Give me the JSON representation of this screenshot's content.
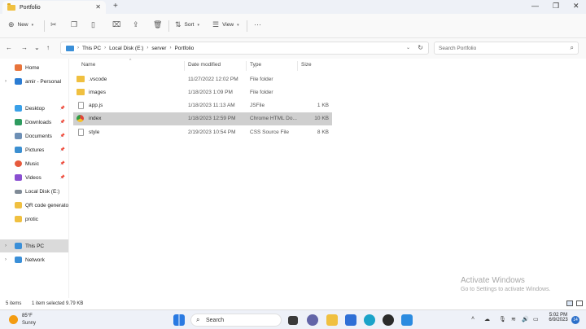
{
  "window": {
    "tab_title": "Portfolio",
    "tab_close": "✕",
    "new_tab": "+",
    "minimize": "—",
    "maximize": "❐",
    "close": "✕"
  },
  "toolbar": {
    "new_label": "New",
    "sort_label": "Sort",
    "view_label": "View",
    "more_label": "···"
  },
  "address": {
    "breadcrumbs": [
      "This PC",
      "Local Disk (E:)",
      "server",
      "Portfolio"
    ],
    "search_placeholder": "Search Portfolio"
  },
  "sidebar": {
    "items": [
      {
        "label": "Home",
        "icon": "home-icon",
        "color": "#e8743b"
      },
      {
        "label": "amir - Personal",
        "icon": "cloud-icon",
        "color": "#2b7cd3"
      },
      {
        "label": "Desktop",
        "icon": "desktop-icon",
        "color": "#3aa0e8"
      },
      {
        "label": "Downloads",
        "icon": "download-icon",
        "color": "#2e9b5f"
      },
      {
        "label": "Documents",
        "icon": "document-icon",
        "color": "#6d8fb5"
      },
      {
        "label": "Pictures",
        "icon": "pictures-icon",
        "color": "#3b8fd1"
      },
      {
        "label": "Music",
        "icon": "music-icon",
        "color": "#e65a3d"
      },
      {
        "label": "Videos",
        "icon": "video-icon",
        "color": "#8a4fd1"
      },
      {
        "label": "Local Disk (E:)",
        "icon": "drive-icon",
        "color": "#7f8a96"
      },
      {
        "label": "QR code generator",
        "icon": "folder-icon",
        "color": "#f0c040"
      },
      {
        "label": "protic",
        "icon": "folder-icon",
        "color": "#f0c040"
      },
      {
        "label": "This PC",
        "icon": "pc-icon",
        "color": "#3a8fd8"
      },
      {
        "label": "Network",
        "icon": "network-icon",
        "color": "#3a8fd8"
      }
    ]
  },
  "columns": {
    "name": "Name",
    "date": "Date modified",
    "type": "Type",
    "size": "Size"
  },
  "files": [
    {
      "name": ".vscode",
      "date": "11/27/2022 12:02 PM",
      "type": "File folder",
      "size": "",
      "icon": "folder-icon",
      "color": "#f0c040"
    },
    {
      "name": "images",
      "date": "1/18/2023 1:09 PM",
      "type": "File folder",
      "size": "",
      "icon": "folder-icon",
      "color": "#f0c040"
    },
    {
      "name": "app.js",
      "date": "1/18/2023 11:13 AM",
      "type": "JSFile",
      "size": "1 KB",
      "icon": "js-file-icon",
      "color": "#d8d8d8"
    },
    {
      "name": "index",
      "date": "1/18/2023 12:59 PM",
      "type": "Chrome HTML Do...",
      "size": "10 KB",
      "icon": "chrome-icon",
      "color": "#e2443a"
    },
    {
      "name": "style",
      "date": "2/19/2023 10:54 PM",
      "type": "CSS Source File",
      "size": "8 KB",
      "icon": "css-file-icon",
      "color": "#d8d8d8"
    }
  ],
  "status": {
    "items_count": "5 items",
    "selection": "1 item selected  9.79 KB"
  },
  "watermark": {
    "line1": "Activate Windows",
    "line2": "Go to Settings to activate Windows."
  },
  "taskbar": {
    "temperature": "85°F",
    "weather": "Sunny",
    "search_label": "Search",
    "time": "5:02 PM",
    "date": "6/9/2023",
    "notification_count": "14"
  }
}
